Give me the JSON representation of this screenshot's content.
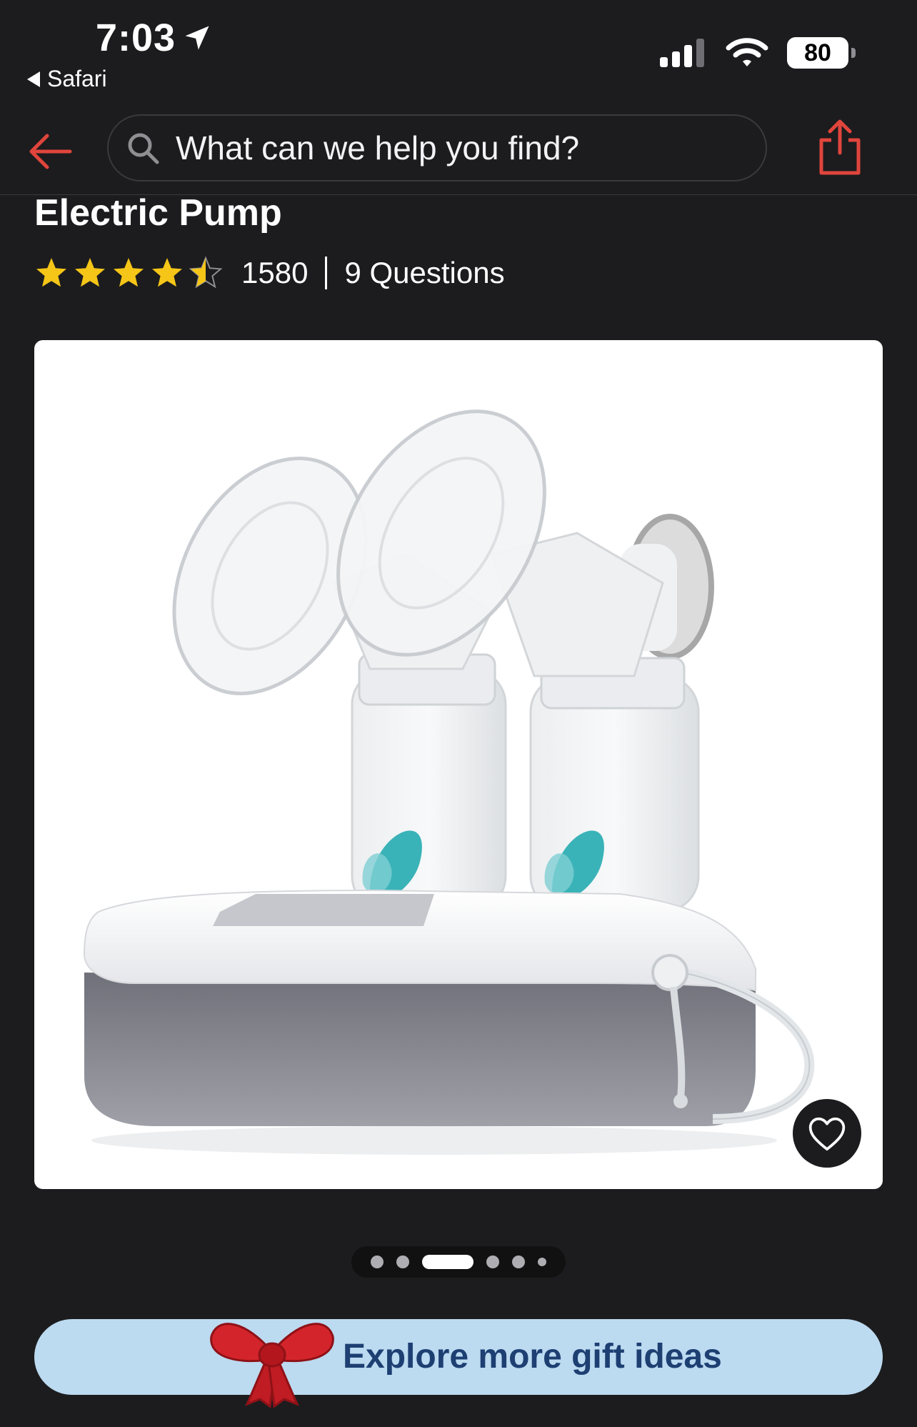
{
  "status_bar": {
    "time": "7:03",
    "back_app": "Safari",
    "battery": "80"
  },
  "nav": {
    "search_placeholder": "What can we help you find?"
  },
  "product": {
    "title": "Electric Pump",
    "rating_stars": 4.5,
    "rating_count": "1580",
    "questions": "9 Questions"
  },
  "carousel": {
    "total": 6,
    "active_index": 2
  },
  "banner": {
    "label": "Explore more gift ideas"
  },
  "colors": {
    "accent": "#e0453c",
    "star": "#f5c518",
    "banner_bg": "#bcdaf0",
    "banner_text": "#1d3f72"
  }
}
